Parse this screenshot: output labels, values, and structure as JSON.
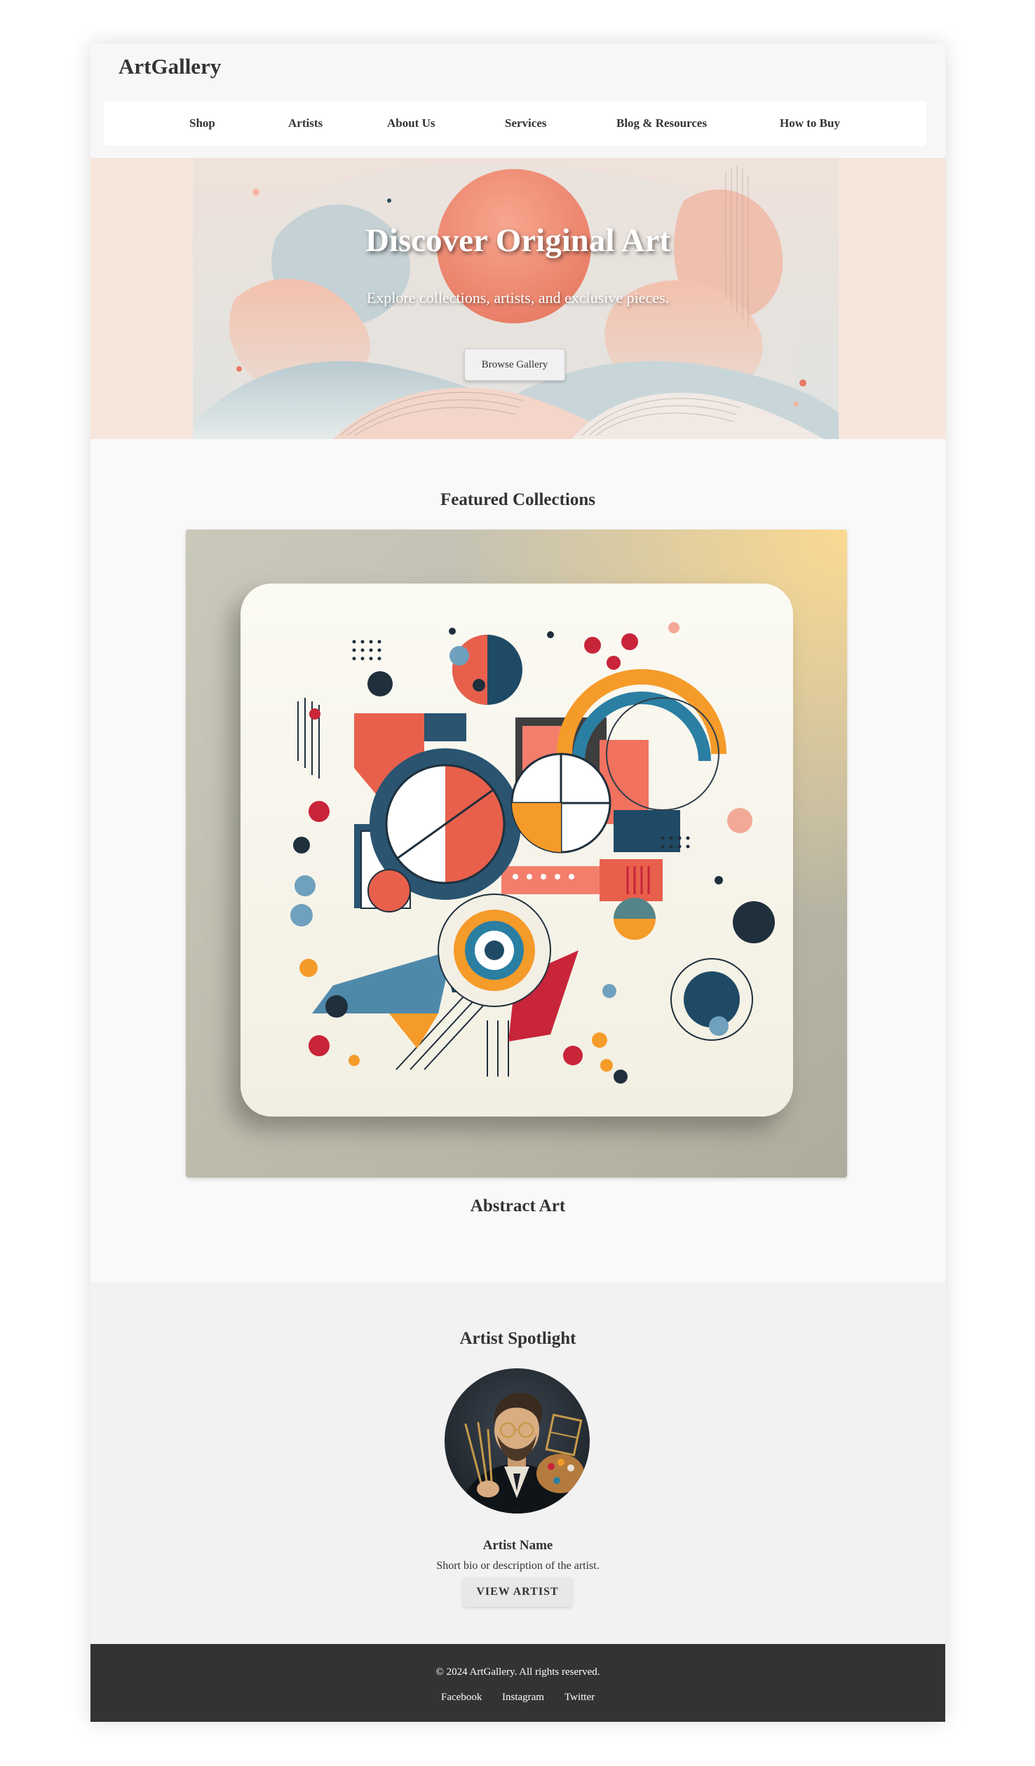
{
  "header": {
    "logo": "ArtGallery",
    "nav": [
      "Shop",
      "Artists",
      "About Us",
      "Services",
      "Blog & Resources",
      "How to Buy"
    ]
  },
  "hero": {
    "title": "Discover Original Art",
    "subtitle": "Explore collections, artists, and exclusive pieces.",
    "button_label": "Browse Gallery"
  },
  "featured": {
    "title": "Featured Collections",
    "collections": [
      {
        "caption": "Abstract Art"
      }
    ]
  },
  "spotlight": {
    "title": "Artist Spotlight",
    "artist_name": "Artist Name",
    "artist_bio": "Short bio or description of the artist.",
    "button_label": "VIEW ARTIST"
  },
  "footer": {
    "copyright": "© 2024 ArtGallery. All rights reserved.",
    "social": [
      "Facebook",
      "Instagram",
      "Twitter"
    ]
  },
  "colors": {
    "page_bg": "#f9f9f9",
    "hero_bg": "#f6e6dc",
    "spotlight_bg": "#f2f2f2",
    "footer_bg": "#333333",
    "text": "#333333"
  }
}
